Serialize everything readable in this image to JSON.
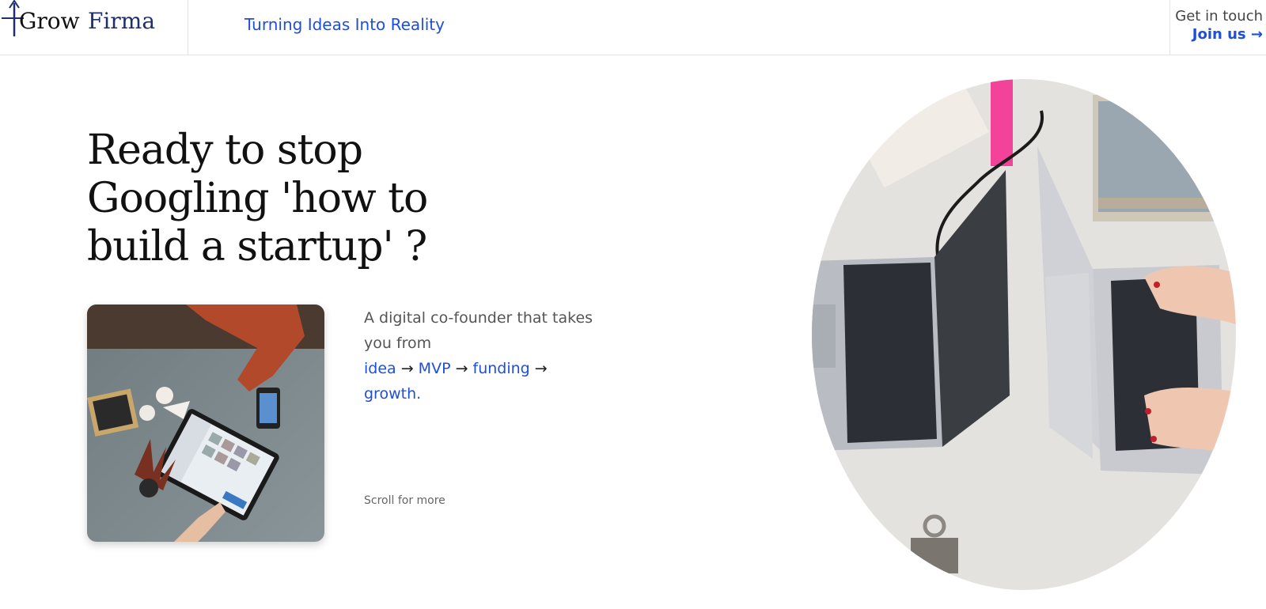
{
  "brand": {
    "name_part1": "Grow",
    "name_part2": "Firma",
    "color": "#1f2f6e"
  },
  "header": {
    "tagline": "Turning Ideas Into Reality",
    "contact_label": "Get in touch",
    "contact_cta": "Join us →"
  },
  "hero": {
    "headline_line1": "Ready to stop",
    "headline_line2": "Googling 'how to",
    "headline_line3": "build a startup' ?",
    "description": "A digital co-founder that takes you from",
    "flow": [
      {
        "label": "idea",
        "arrow": " → "
      },
      {
        "label": "MVP",
        "arrow": " → "
      },
      {
        "label": "funding",
        "arrow": " → "
      },
      {
        "label": "growth.",
        "arrow": ""
      }
    ],
    "scroll_hint": "Scroll for more"
  },
  "colors": {
    "accent": "#1f4fd8",
    "text": "#111111",
    "muted": "#555555"
  }
}
